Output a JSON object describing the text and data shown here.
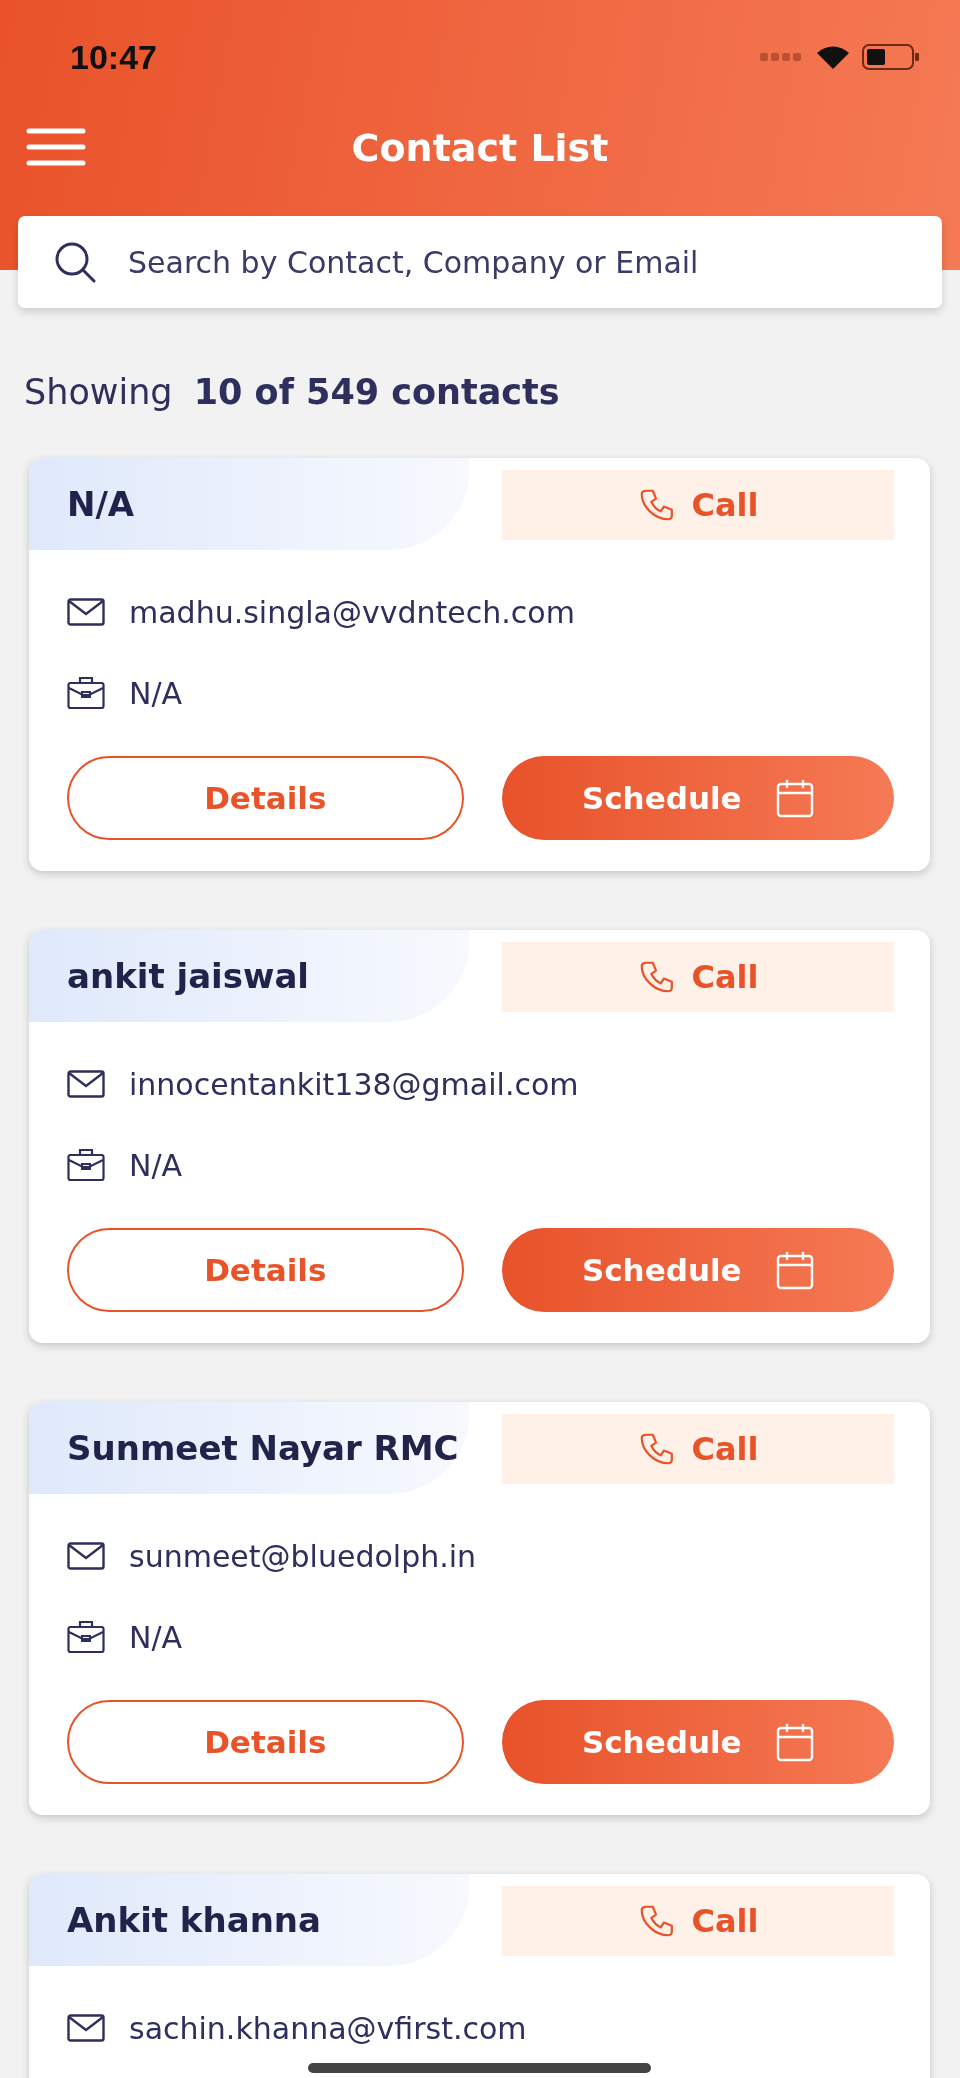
{
  "status_bar": {
    "time": "10:47"
  },
  "header": {
    "title": "Contact List"
  },
  "search": {
    "placeholder": "Search by Contact, Company or Email"
  },
  "summary": {
    "prefix": "Showing",
    "count": "10 of 549 contacts"
  },
  "contacts": [
    {
      "name": "N/A",
      "call": "Call",
      "email": "madhu.singla@vvdntech.com",
      "company": "N/A",
      "details": "Details",
      "schedule": "Schedule"
    },
    {
      "name": "ankit jaiswal",
      "call": "Call",
      "email": "innocentankit138@gmail.com",
      "company": "N/A",
      "details": "Details",
      "schedule": "Schedule"
    },
    {
      "name": "Sunmeet Nayar RMC",
      "call": "Call",
      "email": "sunmeet@bluedolph.in",
      "company": "N/A",
      "details": "Details",
      "schedule": "Schedule"
    },
    {
      "name": "Ankit khanna",
      "call": "Call",
      "email": "sachin.khanna@vfirst.com"
    }
  ]
}
